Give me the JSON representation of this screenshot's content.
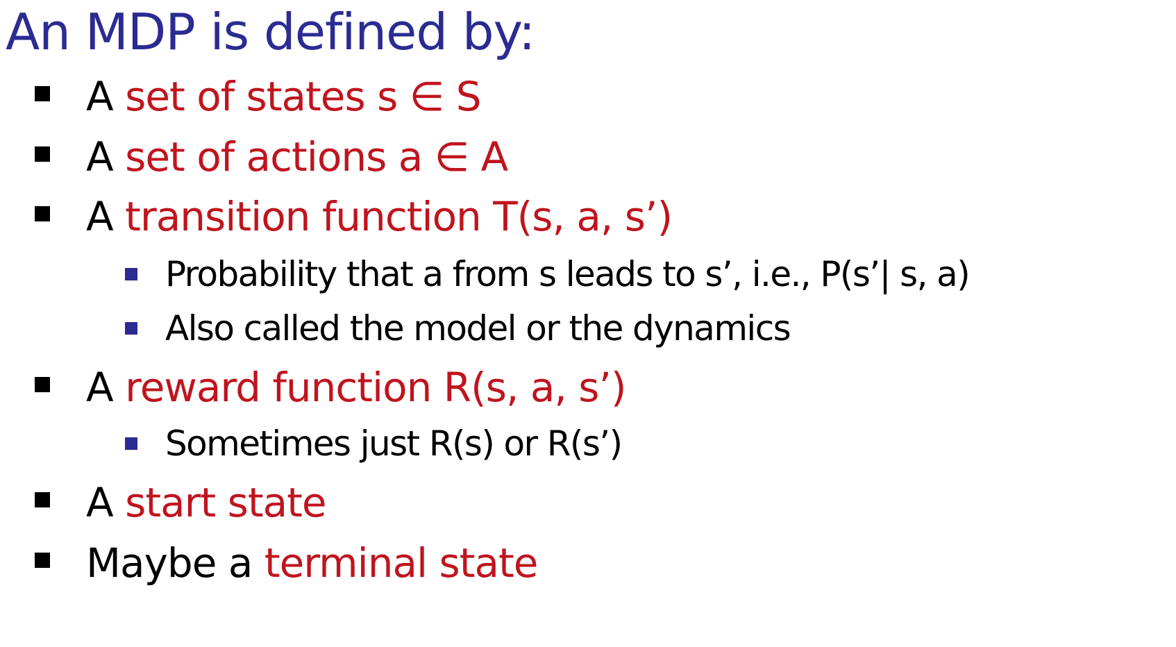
{
  "slide": {
    "title": "An MDP is defined by:",
    "colors": {
      "title": "#2b2b92",
      "highlight": "#c0141e",
      "bullet_l1": "#000000",
      "bullet_l2": "#2b2b92",
      "text": "#000000"
    },
    "items": [
      {
        "prefix": "A ",
        "highlight": "set of states s ∈ S",
        "suffix": ""
      },
      {
        "prefix": "A ",
        "highlight": "set of actions a ∈ A",
        "suffix": ""
      },
      {
        "prefix": "A ",
        "highlight": "transition function T(s, a, s’)",
        "suffix": ""
      },
      {
        "text": "Probability that a from s leads to s’, i.e., P(s’| s, a)"
      },
      {
        "text": "Also called the model or the dynamics"
      },
      {
        "prefix": "A ",
        "highlight": "reward function R(s, a, s’)",
        "suffix": ""
      },
      {
        "text": "Sometimes just R(s) or R(s’)"
      },
      {
        "prefix": "A ",
        "highlight": "start state",
        "suffix": ""
      },
      {
        "prefix": "Maybe a ",
        "highlight": "terminal state",
        "suffix": ""
      }
    ]
  }
}
